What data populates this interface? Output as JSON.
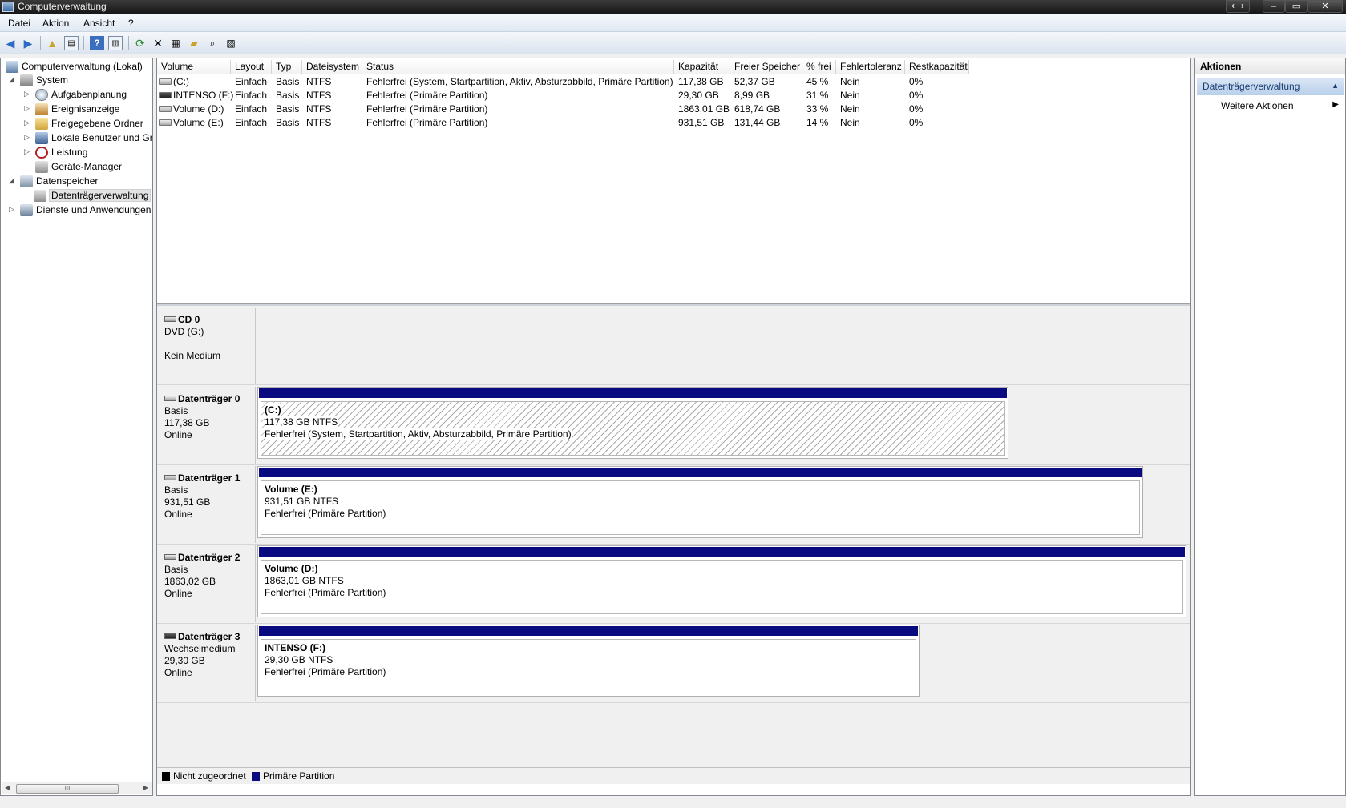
{
  "window": {
    "title": "Computerverwaltung",
    "buttons": {
      "swap": "⟷",
      "minimize": "–",
      "maximize": "▭",
      "close": "✕"
    }
  },
  "menu": [
    "Datei",
    "Aktion",
    "Ansicht",
    "?"
  ],
  "tree": {
    "items": [
      {
        "label": "Computerverwaltung (Lokal)",
        "icon": "computer-icon",
        "expander": ""
      },
      {
        "label": "System",
        "icon": "tools-icon",
        "expander": "◢"
      },
      {
        "label": "Aufgabenplanung",
        "icon": "clock-icon",
        "expander": "▷"
      },
      {
        "label": "Ereignisanzeige",
        "icon": "event-viewer-icon",
        "expander": "▷"
      },
      {
        "label": "Freigegebene Ordner",
        "icon": "shared-folder-icon",
        "expander": "▷"
      },
      {
        "label": "Lokale Benutzer und Gr",
        "icon": "users-icon",
        "expander": "▷"
      },
      {
        "label": "Leistung",
        "icon": "performance-icon",
        "expander": "▷"
      },
      {
        "label": "Geräte-Manager",
        "icon": "device-manager-icon",
        "expander": ""
      },
      {
        "label": "Datenspeicher",
        "icon": "storage-icon",
        "expander": "◢"
      },
      {
        "label": "Datenträgerverwaltung",
        "icon": "disk-management-icon",
        "expander": ""
      },
      {
        "label": "Dienste und Anwendungen",
        "icon": "services-icon",
        "expander": "▷"
      }
    ],
    "scroll_thumb": "III"
  },
  "table": {
    "columns": [
      "Volume",
      "Layout",
      "Typ",
      "Dateisystem",
      "Status",
      "Kapazität",
      "Freier Speicher",
      "% frei",
      "Fehlertoleranz",
      "Restkapazität"
    ],
    "rows": [
      [
        "(C:)",
        "Einfach",
        "Basis",
        "NTFS",
        "Fehlerfrei (System, Startpartition, Aktiv, Absturzabbild, Primäre Partition)",
        "117,38 GB",
        "52,37 GB",
        "45 %",
        "Nein",
        "0%"
      ],
      [
        "INTENSO (F:)",
        "Einfach",
        "Basis",
        "NTFS",
        "Fehlerfrei (Primäre Partition)",
        "29,30 GB",
        "8,99 GB",
        "31 %",
        "Nein",
        "0%"
      ],
      [
        "Volume (D:)",
        "Einfach",
        "Basis",
        "NTFS",
        "Fehlerfrei (Primäre Partition)",
        "1863,01 GB",
        "618,74 GB",
        "33 %",
        "Nein",
        "0%"
      ],
      [
        "Volume (E:)",
        "Einfach",
        "Basis",
        "NTFS",
        "Fehlerfrei (Primäre Partition)",
        "931,51 GB",
        "131,44 GB",
        "14 %",
        "Nein",
        "0%"
      ]
    ]
  },
  "disks": [
    {
      "name": "CD 0",
      "line1": "DVD (G:)",
      "line2": "",
      "line3": "Kein Medium"
    },
    {
      "name": "Datenträger 0",
      "line1": "Basis",
      "line2": "117,38 GB",
      "line3": "Online",
      "partition": {
        "name": "(C:)",
        "size": "117,38 GB NTFS",
        "status": "Fehlerfrei (System, Startpartition, Aktiv, Absturzabbild, Primäre Partition)"
      }
    },
    {
      "name": "Datenträger 1",
      "line1": "Basis",
      "line2": "931,51 GB",
      "line3": "Online",
      "partition": {
        "name": "Volume  (E:)",
        "size": "931,51 GB NTFS",
        "status": "Fehlerfrei (Primäre Partition)"
      }
    },
    {
      "name": "Datenträger 2",
      "line1": "Basis",
      "line2": "1863,02 GB",
      "line3": "Online",
      "partition": {
        "name": "Volume  (D:)",
        "size": "1863,01 GB NTFS",
        "status": "Fehlerfrei (Primäre Partition)"
      }
    },
    {
      "name": "Datenträger 3",
      "line1": "Wechselmedium",
      "line2": "29,30 GB",
      "line3": "Online",
      "partition": {
        "name": "INTENSO  (F:)",
        "size": "29,30 GB NTFS",
        "status": "Fehlerfrei (Primäre Partition)"
      }
    }
  ],
  "legend": {
    "unallocated": {
      "label": "Nicht zugeordnet",
      "color": "#000000"
    },
    "primary": {
      "label": "Primäre Partition",
      "color": "#0a0a80"
    }
  },
  "actions": {
    "title": "Aktionen",
    "section": "Datenträgerverwaltung",
    "more": "Weitere Aktionen"
  }
}
